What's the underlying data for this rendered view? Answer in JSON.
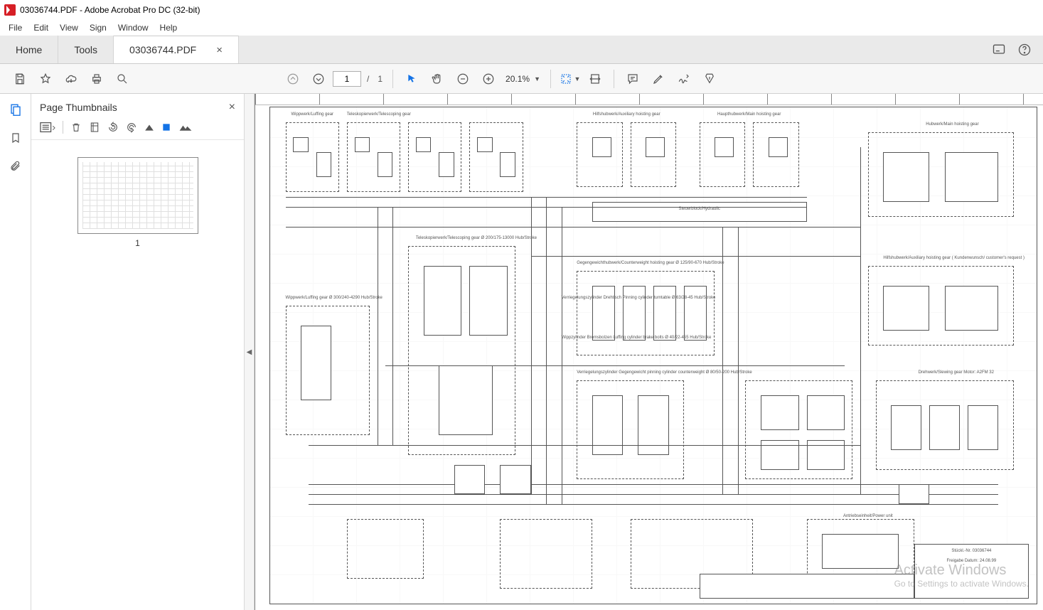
{
  "window": {
    "title": "03036744.PDF - Adobe Acrobat Pro DC (32-bit)"
  },
  "menu": {
    "items": [
      "File",
      "Edit",
      "View",
      "Sign",
      "Window",
      "Help"
    ]
  },
  "tabs": {
    "home": "Home",
    "tools": "Tools",
    "doc": "03036744.PDF"
  },
  "toolbar": {
    "page_current": "1",
    "page_sep": "/",
    "page_total": "1",
    "zoom": "20.1%"
  },
  "thumb": {
    "title": "Page Thumbnails",
    "page_label": "1"
  },
  "schematic": {
    "labels": {
      "luffing_top": "Wippwerk/Luffing gear",
      "telescoping_top": "Teleskopierwerk/Telescoping gear",
      "aux_hoist_top": "Hilfshubwerk/Auxiliary hoisting gear",
      "main_hoist_top": "Haupthubwerk/Main hoisting gear",
      "main_hoist_right": "Hubwerk/Main hoisting gear",
      "steuerblock": "Steuerblock/Hydraulic",
      "telescoping_mid": "Teleskopierwerk/Telescoping gear\nØ 200/175-13000 Hub/Stroke",
      "luffing_mid": "Wippwerk/Luffing gear\nØ 300/240-4290 Hub/Stroke",
      "counterweight": "Gegengewichthubwerk/Counterweight hoisting gear\nØ 125/90-670 Hub/Stroke",
      "mounting_valve": "Verriegelungszylinder Drehtisch\nPinning cylinder turntable\nØ 63/28-45 Hub/Stroke",
      "luffing_brake": "Wippzylinder Bremsbolzen\nLuffing cylinder brake bolts\nØ 40/22-455 Hub/Stroke",
      "counterweight_pin": "Verriegelungszylinder Gegengewicht\npinning cylinder counterweight\nØ 80/50-200 Hub/Stroke",
      "aux_hoist_right": "Hilfshubwerk/Auxiliary hoisting gear\n( Kundenwunsch/ customer's request )",
      "slewing": "Drehwerk/Slewing gear\nMotor: A2FM 32",
      "power_unit": "Antriebseinheit/Power unit",
      "block_nr": "Stückl.-Nr. 03036744",
      "date": "Freigabe Datum: 24.08.99"
    }
  },
  "watermark": {
    "line1": "Activate Windows",
    "line2": "Go to Settings to activate Windows."
  }
}
